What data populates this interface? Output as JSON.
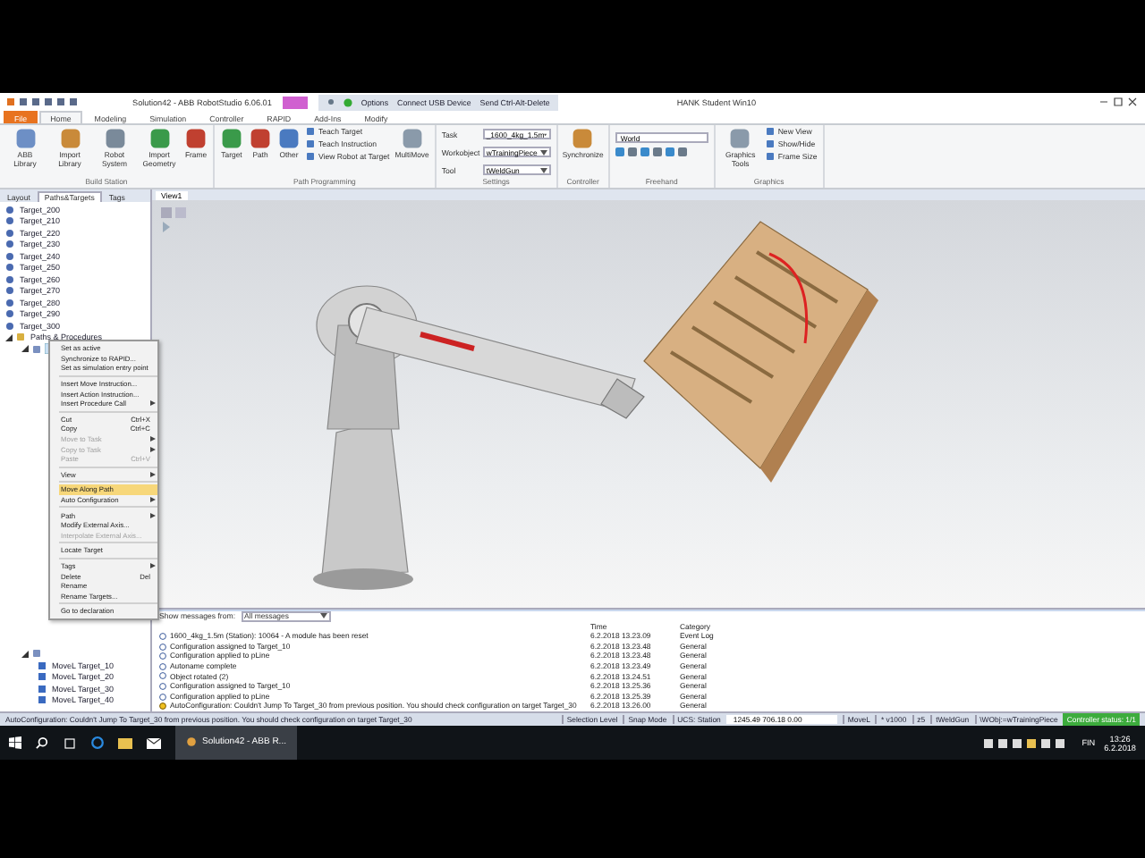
{
  "title_bar": {
    "title": "Solution42 - ABB RobotStudio 6.06.01",
    "remote_actions": [
      "Options",
      "Connect USB Device",
      "Send Ctrl-Alt-Delete"
    ],
    "session": "HANK Student Win10"
  },
  "ribbon_tabs": [
    {
      "label": "File",
      "kind": "file",
      "selected": false
    },
    {
      "label": "Home",
      "kind": "tab",
      "selected": true
    },
    {
      "label": "Modeling",
      "kind": "tab",
      "selected": false
    },
    {
      "label": "Simulation",
      "kind": "tab",
      "selected": false
    },
    {
      "label": "Controller",
      "kind": "tab",
      "selected": false
    },
    {
      "label": "RAPID",
      "kind": "tab",
      "selected": false
    },
    {
      "label": "Add-Ins",
      "kind": "tab",
      "selected": false
    },
    {
      "label": "Modify",
      "kind": "tab",
      "selected": false
    }
  ],
  "ribbon_groups": [
    {
      "title": "Build Station",
      "items": [
        {
          "kind": "large",
          "label": "ABB Library"
        },
        {
          "kind": "large",
          "label": "Import Library"
        },
        {
          "kind": "large",
          "label": "Robot System"
        },
        {
          "kind": "large",
          "label": "Import Geometry"
        },
        {
          "kind": "large",
          "label": "Frame"
        }
      ]
    },
    {
      "title": "Path Programming",
      "items": [
        {
          "kind": "large",
          "label": "Target"
        },
        {
          "kind": "large",
          "label": "Path"
        },
        {
          "kind": "large",
          "label": "Other"
        },
        {
          "kind": "stack",
          "rows": [
            "Teach Target",
            "Teach Instruction",
            "View Robot at Target"
          ]
        },
        {
          "kind": "large",
          "label": "MultiMove"
        }
      ]
    },
    {
      "title": "Settings",
      "items": [
        {
          "kind": "settings",
          "rows": [
            {
              "label": "Task",
              "value": "_1600_4kg_1.5m"
            },
            {
              "label": "Workobject",
              "value": "wTrainingPiece"
            },
            {
              "label": "Tool",
              "value": "tWeldGun"
            }
          ]
        }
      ]
    },
    {
      "title": "Controller",
      "items": [
        {
          "kind": "large",
          "label": "Synchronize"
        }
      ]
    },
    {
      "title": "Freehand",
      "items": [
        {
          "kind": "field",
          "value": "World"
        }
      ]
    },
    {
      "title": "Graphics",
      "items": [
        {
          "kind": "large",
          "label": "Graphics Tools"
        },
        {
          "kind": "stack",
          "rows": [
            "New View",
            "Show/Hide",
            "Frame Size"
          ]
        }
      ]
    }
  ],
  "panel_tabs": [
    {
      "label": "Layout",
      "selected": false
    },
    {
      "label": "Paths&Targets",
      "selected": true
    },
    {
      "label": "Tags",
      "selected": false
    }
  ],
  "tree": [
    {
      "kind": "target",
      "label": "Target_200",
      "selected": false
    },
    {
      "kind": "target",
      "label": "Target_210",
      "selected": false
    },
    {
      "kind": "target",
      "label": "Target_220",
      "selected": false
    },
    {
      "kind": "target",
      "label": "Target_230",
      "selected": false
    },
    {
      "kind": "target",
      "label": "Target_240",
      "selected": false
    },
    {
      "kind": "target",
      "label": "Target_250",
      "selected": false
    },
    {
      "kind": "target",
      "label": "Target_260",
      "selected": false
    },
    {
      "kind": "target",
      "label": "Target_270",
      "selected": false
    },
    {
      "kind": "target",
      "label": "Target_280",
      "selected": false
    },
    {
      "kind": "target",
      "label": "Target_290",
      "selected": false
    },
    {
      "kind": "target",
      "label": "Target_300",
      "selected": false
    },
    {
      "kind": "folder",
      "label": "Paths & Procedures",
      "selected": false,
      "expanded": true,
      "children": [
        {
          "kind": "path",
          "selected": true,
          "expanded": true
        },
        {
          "kind": "path",
          "selected": false,
          "expanded": true,
          "children": [
            {
              "kind": "instruction",
              "label": "MoveL Target_10",
              "selected": false
            },
            {
              "kind": "instruction",
              "label": "MoveL Target_20",
              "selected": false
            },
            {
              "kind": "instruction",
              "label": "MoveL Target_30",
              "selected": false
            },
            {
              "kind": "instruction",
              "label": "MoveL Target_40",
              "selected": false
            }
          ]
        }
      ]
    }
  ],
  "view_tab": {
    "label": "View1"
  },
  "context_menu": [
    {
      "kind": "item",
      "label": "Set as active",
      "submenu": false,
      "disabled": false,
      "highlighted": false
    },
    {
      "kind": "item",
      "label": "Synchronize to RAPID...",
      "submenu": false,
      "disabled": false,
      "highlighted": false
    },
    {
      "kind": "item",
      "label": "Set as simulation entry point",
      "submenu": false,
      "disabled": false,
      "highlighted": false
    },
    {
      "kind": "separator"
    },
    {
      "kind": "item",
      "label": "Insert Move Instruction...",
      "submenu": false,
      "disabled": false,
      "highlighted": false
    },
    {
      "kind": "item",
      "label": "Insert Action Instruction...",
      "submenu": false,
      "disabled": false,
      "highlighted": false
    },
    {
      "kind": "item",
      "label": "Insert Procedure Call",
      "submenu": true,
      "disabled": false,
      "highlighted": false
    },
    {
      "kind": "separator"
    },
    {
      "kind": "item",
      "label": "Cut",
      "shortcut": "Ctrl+X",
      "submenu": false,
      "disabled": false,
      "highlighted": false
    },
    {
      "kind": "item",
      "label": "Copy",
      "shortcut": "Ctrl+C",
      "submenu": false,
      "disabled": false,
      "highlighted": false
    },
    {
      "kind": "item",
      "label": "Move to Task",
      "submenu": true,
      "disabled": true,
      "highlighted": false
    },
    {
      "kind": "item",
      "label": "Copy to Task",
      "submenu": true,
      "disabled": true,
      "highlighted": false
    },
    {
      "kind": "item",
      "label": "Paste",
      "shortcut": "Ctrl+V",
      "submenu": false,
      "disabled": true,
      "highlighted": false
    },
    {
      "kind": "separator"
    },
    {
      "kind": "item",
      "label": "View",
      "submenu": true,
      "disabled": false,
      "highlighted": false
    },
    {
      "kind": "separator"
    },
    {
      "kind": "item",
      "label": "Move Along Path",
      "submenu": false,
      "disabled": false,
      "highlighted": true
    },
    {
      "kind": "item",
      "label": "Auto Configuration",
      "submenu": true,
      "disabled": false,
      "highlighted": false
    },
    {
      "kind": "separator"
    },
    {
      "kind": "item",
      "label": "Path",
      "submenu": true,
      "disabled": false,
      "highlighted": false
    },
    {
      "kind": "item",
      "label": "Modify External Axis...",
      "submenu": false,
      "disabled": false,
      "highlighted": false
    },
    {
      "kind": "item",
      "label": "Interpolate External Axis...",
      "submenu": false,
      "disabled": true,
      "highlighted": false
    },
    {
      "kind": "separator"
    },
    {
      "kind": "item",
      "label": "Locate Target",
      "submenu": false,
      "disabled": false,
      "highlighted": false
    },
    {
      "kind": "separator"
    },
    {
      "kind": "item",
      "label": "Tags",
      "submenu": true,
      "disabled": false,
      "highlighted": false
    },
    {
      "kind": "item",
      "label": "Delete",
      "shortcut": "Del",
      "submenu": false,
      "disabled": false,
      "highlighted": false
    },
    {
      "kind": "item",
      "label": "Rename",
      "submenu": false,
      "disabled": false,
      "highlighted": false
    },
    {
      "kind": "item",
      "label": "Rename Targets...",
      "submenu": false,
      "disabled": false,
      "highlighted": false
    },
    {
      "kind": "separator"
    },
    {
      "kind": "item",
      "label": "Go to declaration",
      "submenu": false,
      "disabled": false,
      "highlighted": false
    }
  ],
  "output": {
    "filter_label": "Show messages from:",
    "filter_value": "All messages",
    "columns": [
      "Time",
      "Category"
    ],
    "rows": [
      {
        "kind": "info",
        "message": "1600_4kg_1.5m (Station): 10064 - A module has been reset",
        "time": "6.2.2018 13.23.09",
        "category": "Event Log"
      },
      {
        "kind": "info",
        "message": "Configuration assigned to Target_10",
        "time": "6.2.2018 13.23.48",
        "category": "General"
      },
      {
        "kind": "info",
        "message": "Configuration applied to pLine",
        "time": "6.2.2018 13.23.48",
        "category": "General"
      },
      {
        "kind": "info",
        "message": "Autoname complete",
        "time": "6.2.2018 13.23.49",
        "category": "General"
      },
      {
        "kind": "info",
        "message": "Object rotated (2)",
        "time": "6.2.2018 13.24.51",
        "category": "General"
      },
      {
        "kind": "info",
        "message": "Configuration assigned to Target_10",
        "time": "6.2.2018 13.25.36",
        "category": "General"
      },
      {
        "kind": "info",
        "message": "Configuration applied to pLine",
        "time": "6.2.2018 13.25.39",
        "category": "General"
      },
      {
        "kind": "warning",
        "message": "AutoConfiguration: Couldn't Jump To Target_30 from previous position. You should check configuration on target Target_30",
        "time": "6.2.2018 13.26.00",
        "category": "General"
      }
    ]
  },
  "status_bar": {
    "message": "AutoConfiguration: Couldn't Jump To Target_30 from previous position. You should check configuration on target Target_30",
    "modes": [
      "Selection Level",
      "Snap Mode"
    ],
    "ucs": "UCS: Station",
    "coordinates": "1245.49  706.18  0.00",
    "instruction": [
      "MoveL",
      "* v1000",
      "z5",
      "tWeldGun",
      "\\WObj:=wTrainingPiece"
    ],
    "controller_status": "Controller status: 1/1"
  },
  "taskbar": {
    "apps": [
      {
        "label": "Solution42 - ABB R...",
        "active": true
      }
    ],
    "language": "FIN",
    "time": "13:26",
    "date": "6.2.2018"
  }
}
